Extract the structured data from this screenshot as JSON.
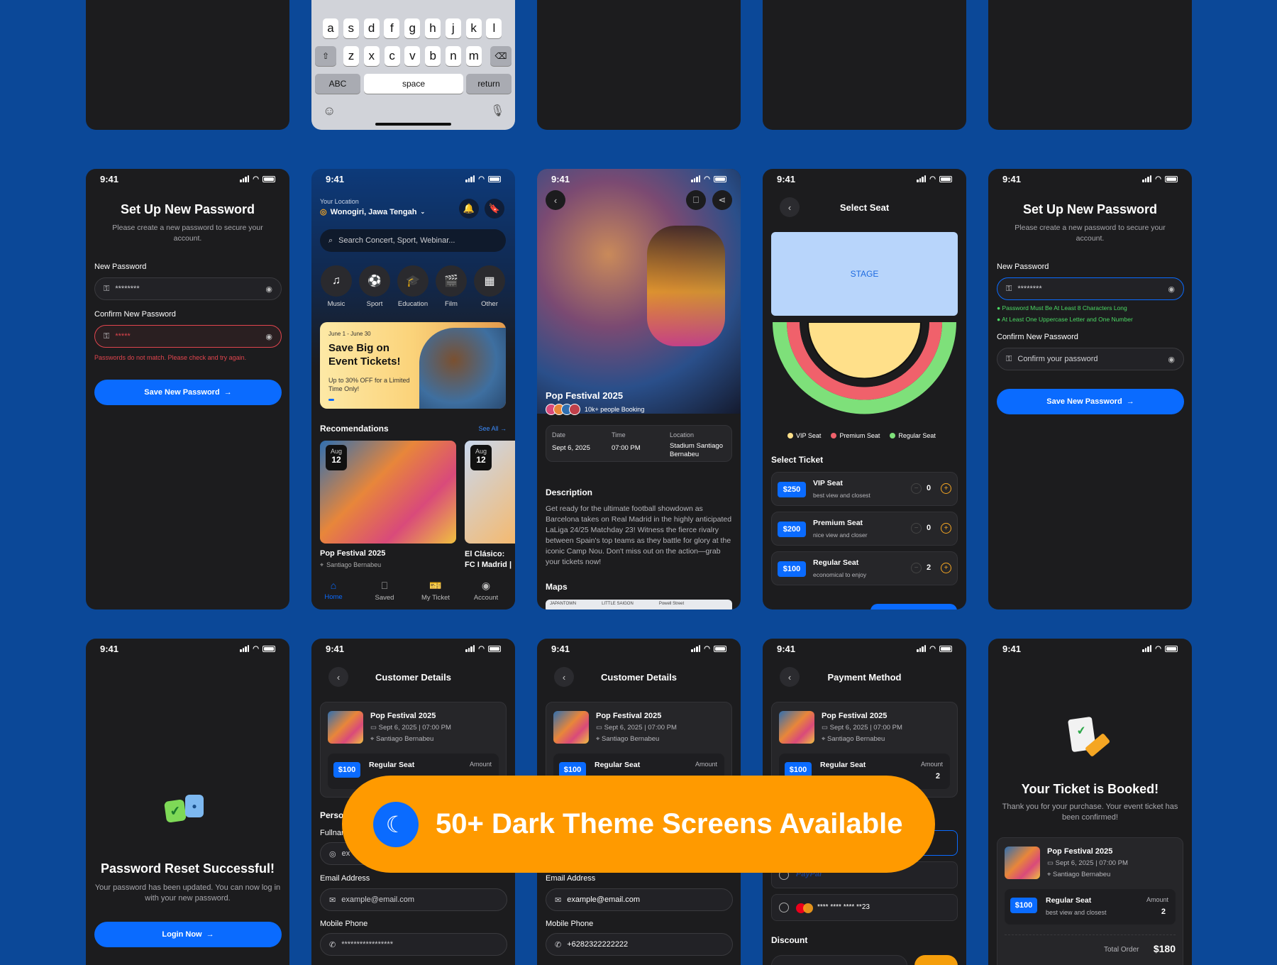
{
  "time": "9:41",
  "keyboard": {
    "row2": [
      "a",
      "s",
      "d",
      "f",
      "g",
      "h",
      "j",
      "k",
      "l"
    ],
    "row3": [
      "z",
      "x",
      "c",
      "v",
      "b",
      "n",
      "m"
    ],
    "abc": "ABC",
    "space": "space",
    "return": "return"
  },
  "setup1": {
    "title": "Set Up New Password",
    "subtitle": "Please create a new password to secure your account.",
    "new_label": "New Password",
    "new_value": "********",
    "confirm_label": "Confirm New Password",
    "confirm_value": "*****",
    "error": "Passwords do not match. Please check and try again.",
    "button": "Save New Password"
  },
  "home": {
    "location_label": "Your Location",
    "location": "Wonogiri, Jawa Tengah",
    "search_placeholder": "Search Concert, Sport, Webinar...",
    "categories": [
      "Music",
      "Sport",
      "Education",
      "Film",
      "Other"
    ],
    "promo_date": "June 1 - June 30",
    "promo_title": "Save Big on Event Tickets!",
    "promo_sub": "Up to 30% OFF for a Limited Time Only!",
    "rec_title": "Recomendations",
    "see_all": "See All",
    "card1": {
      "month": "Aug",
      "day": "12",
      "name": "Pop Festival 2025",
      "venue": "Santiago Bernabeu"
    },
    "card2": {
      "month": "Aug",
      "day": "12",
      "name": "El Clásico: FC I Madrid | LaLig"
    },
    "nav": [
      "Home",
      "Saved",
      "My Ticket",
      "Account"
    ]
  },
  "detail": {
    "name": "Pop Festival 2025",
    "booking": "10k+ people Booking",
    "date_label": "Date",
    "date": "Sept 6, 2025",
    "time_label": "Time",
    "time": "07:00 PM",
    "loc_label": "Location",
    "loc": "Stadium Santiago Bernabeu",
    "desc_title": "Description",
    "desc": "Get ready for the ultimate football showdown as Barcelona takes on Real Madrid in the highly anticipated LaLiga 24/25 Matchday 23! Witness the fierce rivalry between Spain's top teams as they battle for glory at the iconic Camp Nou. Don't miss out on the action—grab your tickets now!",
    "maps": "Maps",
    "map_labels": [
      "JAPANTOWN",
      "LITTLE SAIGON",
      "Powell Street"
    ]
  },
  "seat": {
    "title": "Select Seat",
    "stage": "STAGE",
    "legend": [
      "VIP Seat",
      "Premium Seat",
      "Regular Seat"
    ],
    "colors": {
      "vip": "#FFE08A",
      "premium": "#F0616B",
      "regular": "#7EE07A"
    },
    "ticket_title": "Select Ticket",
    "tickets": [
      {
        "price": "$250",
        "name": "VIP Seat",
        "desc": "best view and closest",
        "qty": "0"
      },
      {
        "price": "$200",
        "name": "Premium Seat",
        "desc": "nice view and closer",
        "qty": "0"
      },
      {
        "price": "$100",
        "name": "Regular Seat",
        "desc": "economical to enjoy",
        "qty": "2"
      }
    ]
  },
  "setup2": {
    "title": "Set Up New Password",
    "subtitle": "Please create a new password to secure your account.",
    "new_label": "New Password",
    "new_value": "********",
    "rule1": "Password Must Be At Least 8 Characters Long",
    "rule2": "At Least One Uppercase Letter and One Number",
    "confirm_label": "Confirm New Password",
    "confirm_placeholder": "Confirm your password",
    "button": "Save New Password"
  },
  "reset": {
    "title": "Password Reset Successful!",
    "subtitle": "Your password has been updated. You can now log in with your new password.",
    "button": "Login Now"
  },
  "order": {
    "name": "Pop Festival 2025",
    "datetime": "Sept 6, 2025 | 07:00 PM",
    "venue": "Santiago Bernabeu",
    "price": "$100",
    "seat": "Regular Seat",
    "seat_desc": "best view and closest",
    "amount_label": "Amount",
    "amount": "2"
  },
  "customer": {
    "title": "Customer Details",
    "person_label": "Perso",
    "fullname_label": "Fullnar",
    "fullname_value": "ex",
    "email_label": "Email Address",
    "email_placeholder": "example@email.com",
    "phone_label": "Mobile Phone",
    "phone_masked": "*****************",
    "phone_value": "+6282322222222"
  },
  "payment": {
    "title": "Payment Method",
    "paypal": "PayPal",
    "card": "**** **** **** **23",
    "discount": "Discount"
  },
  "booked": {
    "title": "Your Ticket is Booked!",
    "subtitle": "Thank you for your purchase. Your event ticket has been confirmed!",
    "total_label": "Total Order",
    "total": "$180"
  },
  "banner": {
    "text": "50+ Dark Theme Screens Available"
  }
}
